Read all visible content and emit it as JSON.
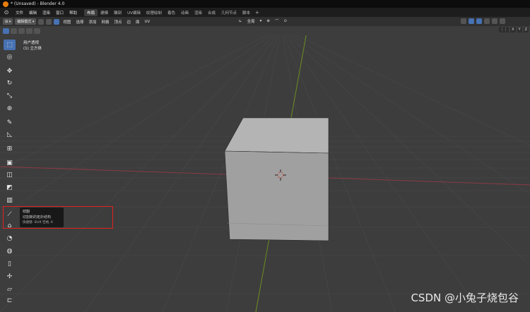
{
  "window": {
    "title": "* (Unsaved) - Blender 4.0"
  },
  "menubar": {
    "items": [
      "文件",
      "编辑",
      "渲染",
      "窗口",
      "帮助"
    ],
    "workspaces": [
      "布局",
      "建模",
      "雕刻",
      "UV编辑",
      "纹理绘制",
      "着色",
      "动画",
      "渲染",
      "合成",
      "几何节点",
      "脚本"
    ],
    "active_workspace": 0,
    "add_label": "+"
  },
  "header": {
    "mode": "编辑模式",
    "menus": [
      "视图",
      "选择",
      "添加",
      "网格",
      "顶点",
      "边",
      "面",
      "UV"
    ],
    "transform_orientation": "全局"
  },
  "viewport": {
    "view_name": "用户透视",
    "object_name": "(1) 立方体"
  },
  "axis_labels": [
    "X",
    "Y",
    "Z"
  ],
  "tooltip": {
    "title": "切割",
    "description": "切割新的拓扑结构",
    "shortcut": "快捷键: Shift 空格, K"
  },
  "watermark": "CSDN @小兔子烧包谷",
  "colors": {
    "accent_blue": "#4772b3",
    "highlight_red": "#e02020",
    "viewport_bg": "#3d3d3d",
    "cube": "#a3a3a3"
  },
  "icons": [
    "select-box-icon",
    "cursor-icon",
    "move-icon",
    "rotate-icon",
    "scale-icon",
    "transform-icon",
    "annotate-icon",
    "measure-icon",
    "add-cube-icon",
    "extrude-icon",
    "inset-icon",
    "bevel-icon",
    "loop-cut-icon",
    "knife-icon",
    "poly-build-icon",
    "spin-icon",
    "smooth-icon",
    "edge-slide-icon",
    "shrink-fatten-icon",
    "shear-icon",
    "rip-icon"
  ]
}
